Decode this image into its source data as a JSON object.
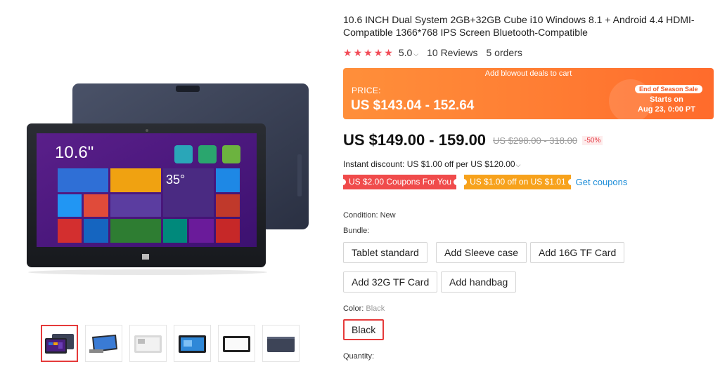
{
  "product": {
    "title": "10.6 INCH Dual System 2GB+32GB Cube i10 Windows 8.1 + Android 4.4 HDMI-Compatible 1366*768 IPS Screen Bluetooth-Compatible",
    "rating": "5.0",
    "reviews": "10 Reviews",
    "orders": "5 orders"
  },
  "promo": {
    "banner_text": "Add blowout deals to cart",
    "price_label": "PRICE:",
    "price": "US $143.04 - 152.64",
    "badge": "End of Season Sale",
    "starts_on_label": "Starts on",
    "starts_on_date": "Aug 23, 0:00 PT"
  },
  "pricing": {
    "price": "US $149.00 - 159.00",
    "old_price": "US $298.00 - 318.00",
    "discount": "-50%",
    "instant_discount": "Instant discount: US $1.00 off per US $120.00"
  },
  "coupons": {
    "items": [
      "US $2.00 Coupons For You",
      "US $1.00 off on US $1.01"
    ],
    "get_coupons": "Get coupons"
  },
  "condition": {
    "label": "Condition: ",
    "value": "New"
  },
  "bundle": {
    "label": "Bundle:",
    "options": [
      "Tablet standard",
      "Add Sleeve case",
      "Add 16G TF Card",
      "Add 32G TF Card",
      "Add handbag"
    ]
  },
  "color": {
    "label": "Color: ",
    "selected": "Black",
    "options": [
      "Black"
    ]
  },
  "quantity": {
    "label": "Quantity:"
  },
  "tablet_screen": {
    "size_text": "10.6\"",
    "temperature": "35°"
  },
  "colors": {
    "accent_red": "#e53a3a",
    "star": "#f24b57",
    "promo_orange": "#ff7d33",
    "coupon_red": "#f04b4b",
    "coupon_orange": "#f7a21c",
    "link_blue": "#1a8cd8"
  },
  "icons": {
    "rating_star": "★",
    "dropdown": "chevron-down"
  }
}
